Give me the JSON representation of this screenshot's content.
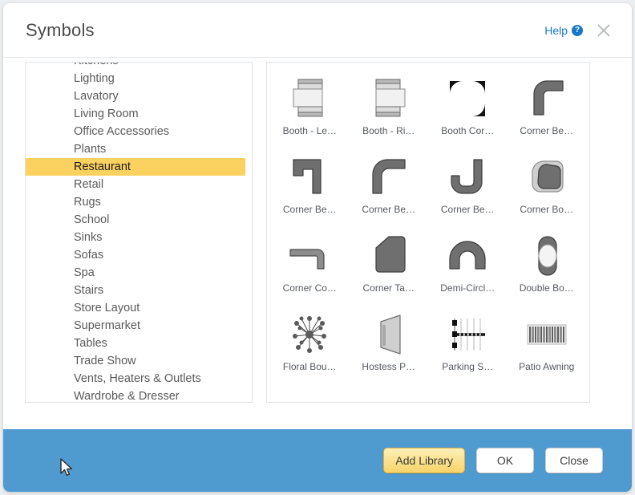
{
  "header": {
    "title": "Symbols",
    "help_label": "Help",
    "help_icon": "question-circle-icon",
    "close_icon": "close-icon"
  },
  "sidebar": {
    "items": [
      {
        "label": "Kitchens",
        "selected": false,
        "clipped": true
      },
      {
        "label": "Lighting",
        "selected": false
      },
      {
        "label": "Lavatory",
        "selected": false
      },
      {
        "label": "Living Room",
        "selected": false
      },
      {
        "label": "Office Accessories",
        "selected": false
      },
      {
        "label": "Plants",
        "selected": false
      },
      {
        "label": "Restaurant",
        "selected": true
      },
      {
        "label": "Retail",
        "selected": false
      },
      {
        "label": "Rugs",
        "selected": false
      },
      {
        "label": "School",
        "selected": false
      },
      {
        "label": "Sinks",
        "selected": false
      },
      {
        "label": "Sofas",
        "selected": false
      },
      {
        "label": "Spa",
        "selected": false
      },
      {
        "label": "Stairs",
        "selected": false
      },
      {
        "label": "Store Layout",
        "selected": false
      },
      {
        "label": "Supermarket",
        "selected": false
      },
      {
        "label": "Tables",
        "selected": false
      },
      {
        "label": "Trade Show",
        "selected": false
      },
      {
        "label": "Vents, Heaters & Outlets",
        "selected": false
      },
      {
        "label": "Wardrobe & Dresser",
        "selected": false,
        "clipped": true
      }
    ],
    "selected_color": "#fbd160"
  },
  "symbols": [
    {
      "label": "Booth - Le…",
      "art": "booth-left"
    },
    {
      "label": "Booth - Ri…",
      "art": "booth-right"
    },
    {
      "label": "Booth Cor…",
      "art": "booth-corner"
    },
    {
      "label": "Corner Be…",
      "art": "corner-bench-round"
    },
    {
      "label": "Corner Be…",
      "art": "corner-bench-angular"
    },
    {
      "label": "Corner Be…",
      "art": "corner-bench-curve"
    },
    {
      "label": "Corner Be…",
      "art": "corner-bench-u"
    },
    {
      "label": "Corner Bo…",
      "art": "corner-booth"
    },
    {
      "label": "Corner Co…",
      "art": "corner-counter"
    },
    {
      "label": "Corner Ta…",
      "art": "corner-table"
    },
    {
      "label": "Demi-Circl…",
      "art": "demi-circle"
    },
    {
      "label": "Double Bo…",
      "art": "double-booth"
    },
    {
      "label": "Floral Bou…",
      "art": "floral-bouquet"
    },
    {
      "label": "Hostess P…",
      "art": "hostess-podium"
    },
    {
      "label": "Parking S…",
      "art": "parking-stall"
    },
    {
      "label": "Patio Awning",
      "art": "patio-awning"
    }
  ],
  "footer": {
    "add_library_label": "Add Library",
    "ok_label": "OK",
    "close_label": "Close",
    "background_color": "#4f9bd0",
    "add_library_color": "#fbe08a"
  }
}
